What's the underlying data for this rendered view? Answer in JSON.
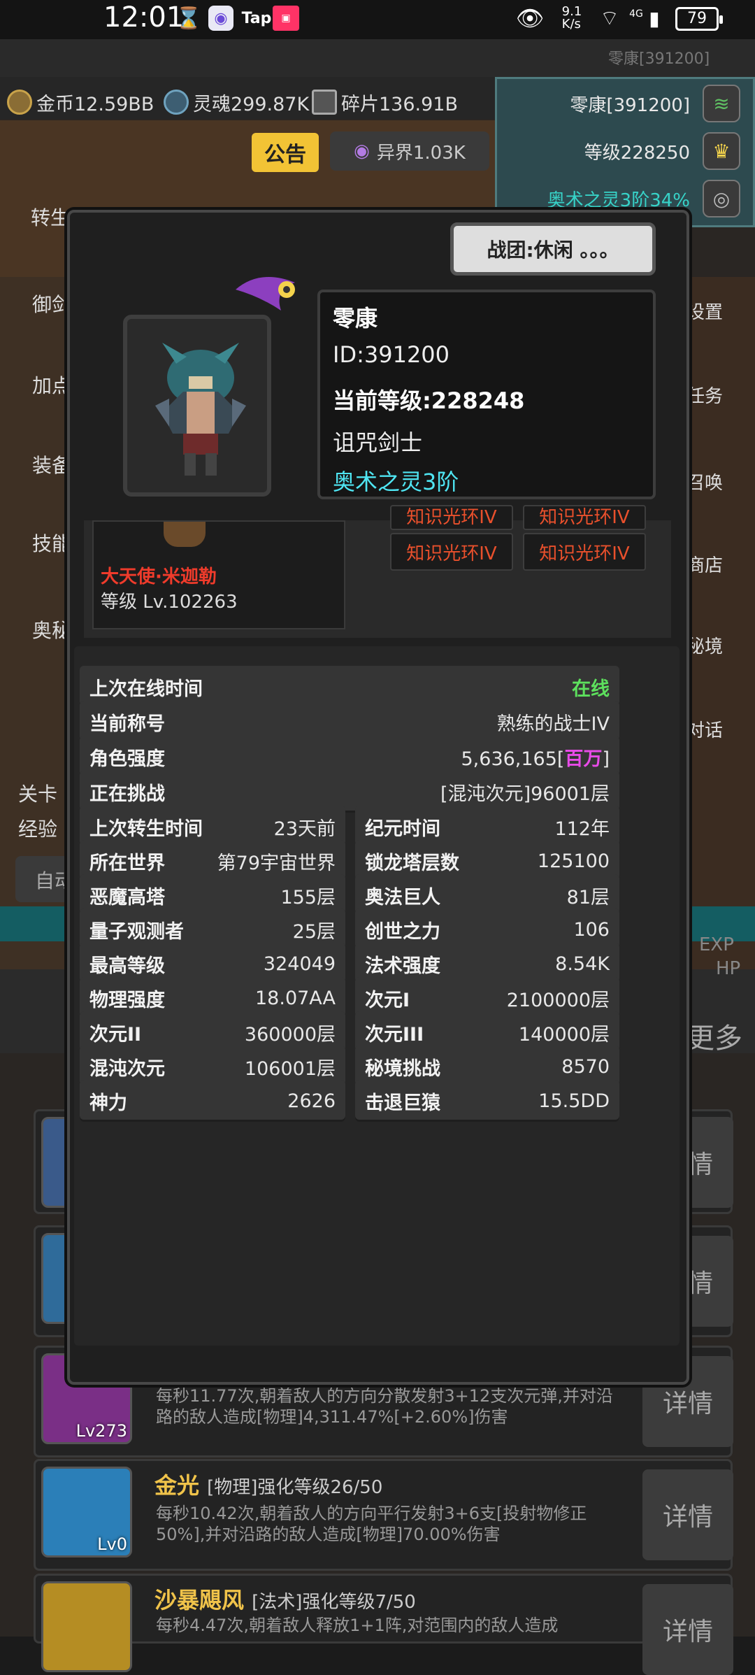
{
  "status_bar": {
    "time": "12:01",
    "speed": "9.1\nK/s",
    "network": "4G",
    "battery": "79",
    "tap_label": "Tap"
  },
  "top": {
    "gold": "金币12.59BB",
    "soul": "灵魂299.87K",
    "fragment": "碎片136.91B",
    "player_name_faint": "零康[391200]",
    "player_name": "零康[391200]",
    "level": "等级228250",
    "arcane": "奥术之灵3阶34%",
    "notice": "公告",
    "otherworld": "异界1.03K"
  },
  "side_left": [
    "转生",
    "御剑",
    "加点",
    "装备",
    "技能",
    "奥秘",
    "关卡",
    "经验",
    "自动"
  ],
  "side_right": [
    "设置",
    "任务",
    "召唤",
    "商店",
    "秘境",
    "对话",
    "EXP",
    "HP",
    "更多"
  ],
  "dialog": {
    "team_status": "战团:休闲 。。。",
    "name": "零康",
    "id": "ID:391200",
    "current_level": "当前等级:228248",
    "class": "诅咒剑士",
    "arcane": "奥术之灵3阶",
    "pet_name": "大天使·米迦勒",
    "pet_level": "等级 Lv.102263",
    "halos": [
      "知识光环IV",
      "知识光环IV",
      "知识光环IV",
      "知识光环IV"
    ],
    "last_online_label": "上次在线时间",
    "last_online_value": "在线",
    "title_label": "当前称号",
    "title_value": "熟练的战士IV",
    "power_label": "角色强度",
    "power_value": "5,636,165[",
    "power_unit": "百万",
    "power_close": "]",
    "challenge_label": "正在挑战",
    "challenge_value": "[混沌次元]96001层",
    "stats_left": [
      {
        "k": "上次转生时间",
        "v": "23天前"
      },
      {
        "k": "所在世界",
        "v": "第79宇宙世界"
      },
      {
        "k": "恶魔高塔",
        "v": "155层"
      },
      {
        "k": "量子观测者",
        "v": "25层"
      },
      {
        "k": "最高等级",
        "v": "324049"
      },
      {
        "k": "物理强度",
        "v": "18.07AA"
      },
      {
        "k": "次元II",
        "v": "360000层"
      },
      {
        "k": "混沌次元",
        "v": "106001层"
      },
      {
        "k": "神力",
        "v": "2626"
      }
    ],
    "stats_right": [
      {
        "k": "纪元时间",
        "v": "112年"
      },
      {
        "k": "锁龙塔层数",
        "v": "125100"
      },
      {
        "k": "奥法巨人",
        "v": "81层"
      },
      {
        "k": "创世之力",
        "v": "106"
      },
      {
        "k": "法术强度",
        "v": "8.54K"
      },
      {
        "k": "次元I",
        "v": "2100000层"
      },
      {
        "k": "次元III",
        "v": "140000层"
      },
      {
        "k": "秘境挑战",
        "v": "8570"
      },
      {
        "k": "击退巨猿",
        "v": "15.5DD"
      }
    ]
  },
  "skills": [
    {
      "level": "Lv273",
      "desc": "每秒11.77次,朝着敌人的方向分散发射3+12支次元弹,并对沿路的敌人造成[物理]4,311.47%[+2.60%]伤害",
      "detail": "详情"
    },
    {
      "title": "金光",
      "tag": "[物理]强化等级26/50",
      "level": "Lv0",
      "desc": "每秒10.42次,朝着敌人的方向平行发射3+6支[投射物修正50%],并对沿路的敌人造成[物理]70.00%伤害",
      "detail": "详情"
    },
    {
      "title": "沙暴飓风",
      "tag": "[法术]强化等级7/50",
      "desc": "每秒4.47次,朝着敌人释放1+1阵,对范围内的敌人造成",
      "detail": "详情"
    }
  ],
  "detail_top": [
    "详情",
    "详情"
  ]
}
